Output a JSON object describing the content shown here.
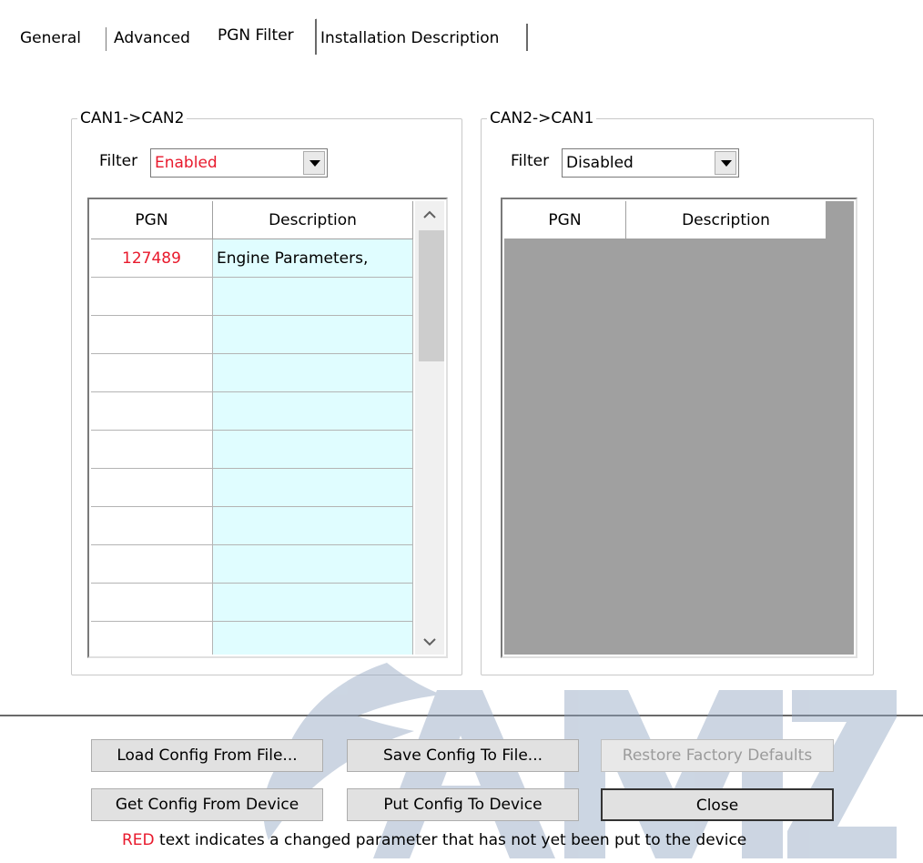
{
  "tabs": [
    {
      "label": "General",
      "active": false
    },
    {
      "label": "Advanced",
      "active": false
    },
    {
      "label": "PGN Filter",
      "active": true
    },
    {
      "label": "Installation Description",
      "active": false
    }
  ],
  "can1_to_can2": {
    "group_title": "CAN1->CAN2",
    "filter_label": "Filter",
    "filter_value": "Enabled",
    "columns": [
      "PGN",
      "Description"
    ],
    "rows": [
      {
        "pgn": "127489",
        "description": "Engine Parameters,"
      },
      {
        "pgn": "",
        "description": ""
      },
      {
        "pgn": "",
        "description": ""
      },
      {
        "pgn": "",
        "description": ""
      },
      {
        "pgn": "",
        "description": ""
      },
      {
        "pgn": "",
        "description": ""
      },
      {
        "pgn": "",
        "description": ""
      },
      {
        "pgn": "",
        "description": ""
      },
      {
        "pgn": "",
        "description": ""
      },
      {
        "pgn": "",
        "description": ""
      },
      {
        "pgn": "",
        "description": ""
      }
    ]
  },
  "can2_to_can1": {
    "group_title": "CAN2->CAN1",
    "filter_label": "Filter",
    "filter_value": "Disabled",
    "columns": [
      "PGN",
      "Description"
    ]
  },
  "buttons": {
    "load": "Load Config From File...",
    "save": "Save Config To File...",
    "restore": "Restore Factory Defaults",
    "get": "Get Config From Device",
    "put": "Put Config To Device",
    "close": "Close"
  },
  "footer": {
    "red_word": "RED",
    "text": " text indicates a changed parameter that has not yet been put to the device"
  },
  "watermark": "AMZ",
  "colors": {
    "changed_red": "#e8192c",
    "description_cell_bg": "#e0fdff",
    "disabled_grid_bg": "#a0a0a0",
    "watermark_blue": "#8fa3c0"
  }
}
